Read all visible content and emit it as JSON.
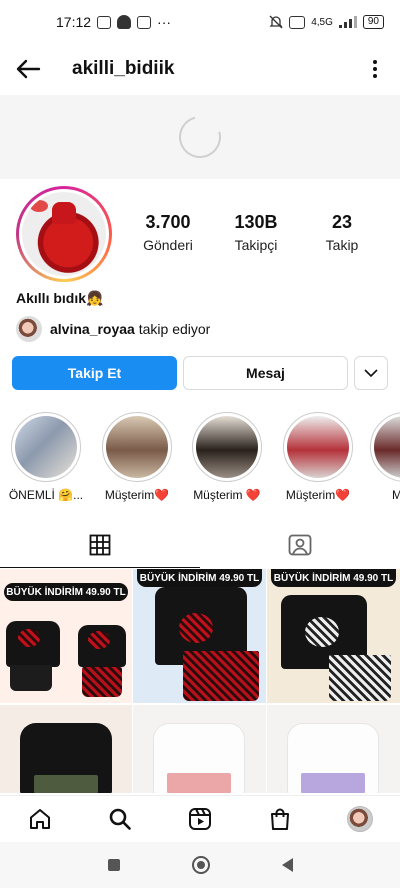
{
  "status_bar": {
    "time": "17:12",
    "network": "4,5G",
    "battery": "90"
  },
  "topbar": {
    "username": "akilli_bidiik",
    "back_icon": "arrow-left-icon",
    "more_icon": "more-vertical-icon"
  },
  "profile": {
    "stats": [
      {
        "value": "3.700",
        "label": "Gönderi"
      },
      {
        "value": "130B",
        "label": "Takipçi"
      },
      {
        "value": "23",
        "label": "Takip"
      }
    ],
    "display_name": "Akıllı bıdık👧",
    "followed_by_user": "alvina_royaa",
    "followed_by_suffix": " takip ediyor"
  },
  "buttons": {
    "follow": "Takip Et",
    "message": "Mesaj"
  },
  "highlights": [
    {
      "label": "ÖNEMLİ 🤗..."
    },
    {
      "label": "Müşterim❤️"
    },
    {
      "label": "Müşterim ❤️"
    },
    {
      "label": "Müşterim❤️"
    },
    {
      "label": "Müşt"
    }
  ],
  "grid": {
    "post_1_banner": "BÜYÜK İNDİRİM 49.90 TL",
    "post_2_banner": "BÜYÜK İNDİRİM 49.90 TL",
    "post_3_banner": "BÜYÜK İNDİRİM 49.90 TL"
  },
  "colors": {
    "accent": "#1a8df2"
  }
}
